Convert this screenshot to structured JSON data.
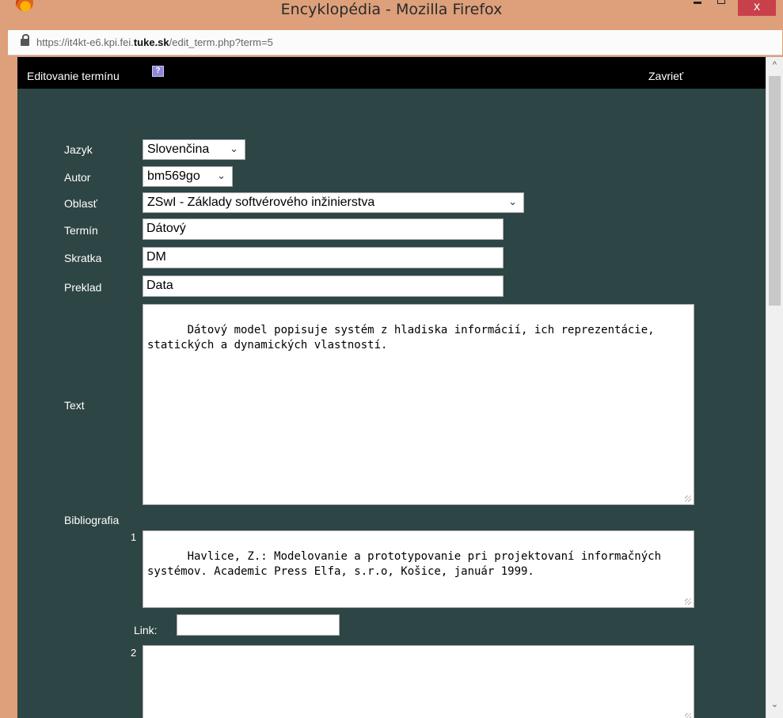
{
  "window": {
    "title": "Encyklopédia - Mozilla Firefox",
    "close_glyph": "x",
    "url_prefix": "https://it4kt-e6.kpi.fei.",
    "url_domain": "tuke.sk",
    "url_suffix": "/edit_term.php?term=5"
  },
  "header": {
    "title": "Editovanie termínu",
    "help_glyph": "?",
    "close_label": "Zavrieť"
  },
  "form": {
    "language_label": "Jazyk",
    "language_value": "Slovenčina",
    "author_label": "Autor",
    "author_value": "bm569go",
    "area_label": "Oblasť",
    "area_value": "ZSwI - Základy softvérového inžinierstva",
    "term_label": "Termín",
    "term_value": "Dátový",
    "abbr_label": "Skratka",
    "abbr_value": "DM",
    "translation_label": "Preklad",
    "translation_value": "Data",
    "text_label": "Text",
    "text_value": "Dátový model popisuje systém z hladiska informácií, ich reprezentácie, statických a dynamických vlastností.",
    "bibliography_label": "Bibliografia",
    "bib": [
      {
        "num": "1",
        "text": "Havlice, Z.: Modelovanie a prototypovanie pri projektovaní informačných systémov. Academic Press Elfa, s.r.o, Košice, január 1999."
      },
      {
        "num": "2",
        "text": ""
      }
    ],
    "link_label": "Link:",
    "link_value": ""
  },
  "icons": {
    "chevron": "⌄",
    "scroll_up": "^",
    "scroll_down": "⌄"
  }
}
